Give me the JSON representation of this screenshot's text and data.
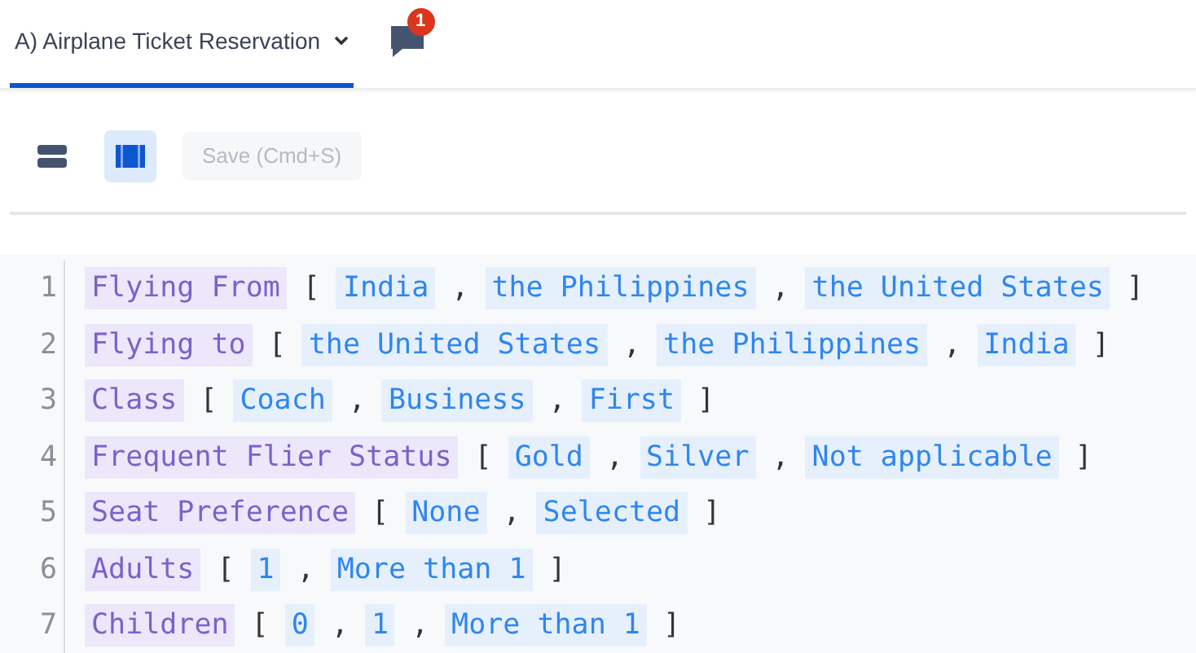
{
  "tabs": [
    {
      "label": "A) Airplane Ticket Reservation",
      "selected": true
    }
  ],
  "comments": {
    "badge": "1"
  },
  "toolbar": {
    "views": [
      {
        "kind": "rows",
        "selected": false
      },
      {
        "kind": "columns",
        "selected": true
      }
    ],
    "save": {
      "label": "Save (Cmd+S)",
      "disabled": true
    }
  },
  "editor": {
    "lines": [
      {
        "number": "1",
        "tokens": [
          {
            "kind": "name",
            "text": "Flying From"
          },
          {
            "kind": "punct",
            "text": "["
          },
          {
            "kind": "value",
            "text": "India"
          },
          {
            "kind": "punct",
            "text": ","
          },
          {
            "kind": "value",
            "text": "the Philippines"
          },
          {
            "kind": "punct",
            "text": ","
          },
          {
            "kind": "value",
            "text": "the United States"
          },
          {
            "kind": "punct",
            "text": "]"
          }
        ]
      },
      {
        "number": "2",
        "tokens": [
          {
            "kind": "name",
            "text": "Flying to"
          },
          {
            "kind": "punct",
            "text": "["
          },
          {
            "kind": "value",
            "text": "the United States"
          },
          {
            "kind": "punct",
            "text": ","
          },
          {
            "kind": "value",
            "text": "the Philippines"
          },
          {
            "kind": "punct",
            "text": ","
          },
          {
            "kind": "value",
            "text": "India"
          },
          {
            "kind": "punct",
            "text": "]"
          }
        ]
      },
      {
        "number": "3",
        "tokens": [
          {
            "kind": "name",
            "text": "Class"
          },
          {
            "kind": "punct",
            "text": "["
          },
          {
            "kind": "value",
            "text": "Coach"
          },
          {
            "kind": "punct",
            "text": ","
          },
          {
            "kind": "value",
            "text": "Business"
          },
          {
            "kind": "punct",
            "text": ","
          },
          {
            "kind": "value",
            "text": "First"
          },
          {
            "kind": "punct",
            "text": "]"
          }
        ]
      },
      {
        "number": "4",
        "tokens": [
          {
            "kind": "name",
            "text": "Frequent Flier Status"
          },
          {
            "kind": "punct",
            "text": "["
          },
          {
            "kind": "value",
            "text": "Gold"
          },
          {
            "kind": "punct",
            "text": ","
          },
          {
            "kind": "value",
            "text": "Silver"
          },
          {
            "kind": "punct",
            "text": ","
          },
          {
            "kind": "value",
            "text": "Not applicable"
          },
          {
            "kind": "punct",
            "text": "]"
          }
        ]
      },
      {
        "number": "5",
        "tokens": [
          {
            "kind": "name",
            "text": "Seat Preference"
          },
          {
            "kind": "punct",
            "text": "["
          },
          {
            "kind": "value",
            "text": "None"
          },
          {
            "kind": "punct",
            "text": ","
          },
          {
            "kind": "value",
            "text": "Selected"
          },
          {
            "kind": "punct",
            "text": "]"
          }
        ]
      },
      {
        "number": "6",
        "tokens": [
          {
            "kind": "name",
            "text": "Adults"
          },
          {
            "kind": "punct",
            "text": "["
          },
          {
            "kind": "value",
            "text": "1"
          },
          {
            "kind": "punct",
            "text": ","
          },
          {
            "kind": "value",
            "text": "More than 1"
          },
          {
            "kind": "punct",
            "text": "]"
          }
        ]
      },
      {
        "number": "7",
        "tokens": [
          {
            "kind": "name",
            "text": "Children"
          },
          {
            "kind": "punct",
            "text": "["
          },
          {
            "kind": "value",
            "text": "0"
          },
          {
            "kind": "punct",
            "text": ","
          },
          {
            "kind": "value",
            "text": "1"
          },
          {
            "kind": "punct",
            "text": ","
          },
          {
            "kind": "value",
            "text": "More than 1"
          },
          {
            "kind": "punct",
            "text": "]"
          }
        ]
      }
    ]
  }
}
